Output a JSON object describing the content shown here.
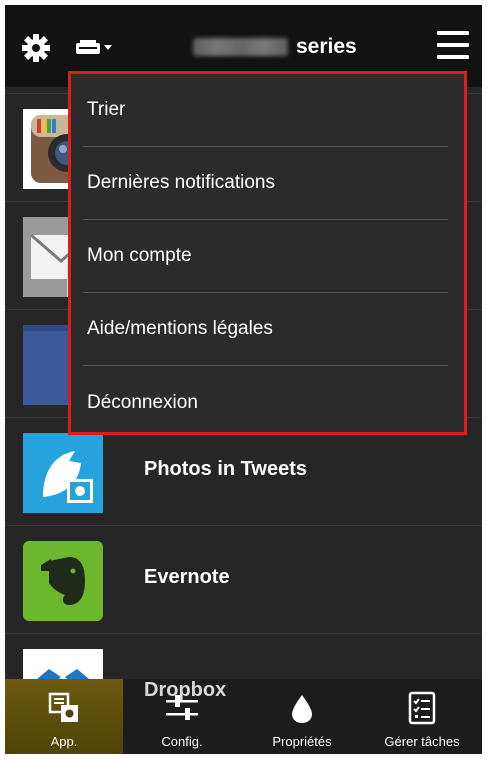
{
  "header": {
    "title_suffix": "series",
    "model_name_obscured": "MB5300"
  },
  "apps": [
    {
      "name": "",
      "icon": "instagram-icon"
    },
    {
      "name": "",
      "icon": "mail-icon"
    },
    {
      "name": "",
      "icon": "facebook-icon"
    },
    {
      "name": "Photos in Tweets",
      "icon": "photos-in-tweets-icon"
    },
    {
      "name": "Evernote",
      "icon": "evernote-icon"
    },
    {
      "name": "Dropbox",
      "icon": "dropbox-icon"
    }
  ],
  "menu": {
    "items": [
      {
        "label": "Trier"
      },
      {
        "label": "Dernières notifications"
      },
      {
        "label": "Mon compte"
      },
      {
        "label": "Aide/mentions légales"
      },
      {
        "label": "Déconnexion"
      }
    ],
    "highlight_color": "#e01b1b"
  },
  "tabs": [
    {
      "label": "App.",
      "icon": "apps-icon",
      "active": true
    },
    {
      "label": "Config.",
      "icon": "sliders-icon",
      "active": false
    },
    {
      "label": "Propriétés",
      "icon": "ink-drop-icon",
      "active": false
    },
    {
      "label": "Gérer tâches",
      "icon": "checklist-icon",
      "active": false
    }
  ]
}
